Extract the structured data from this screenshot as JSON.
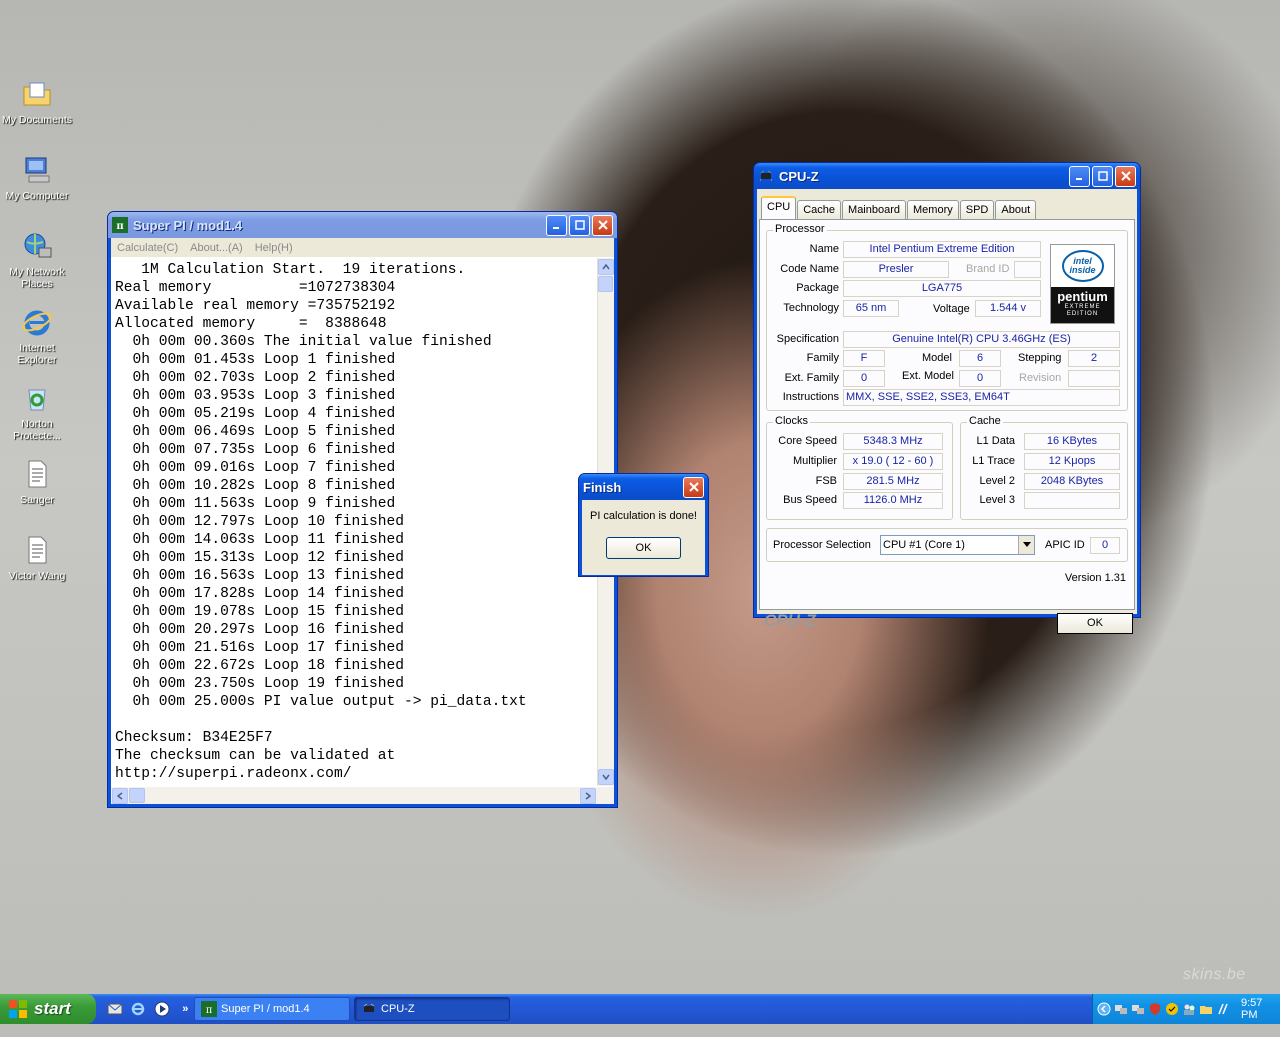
{
  "desktop": {
    "icons": [
      {
        "label": "My Documents"
      },
      {
        "label": "My Computer"
      },
      {
        "label": "My Network Places"
      },
      {
        "label": "Internet Explorer"
      },
      {
        "label": "Norton Protecte..."
      },
      {
        "label": "Sanger"
      },
      {
        "label": "Victor Wang"
      }
    ],
    "watermark": "skins.be"
  },
  "superpi": {
    "title": "Super PI / mod1.4",
    "icon_text": "SUPER π",
    "menu": [
      "Calculate(C)",
      "About...(A)",
      "Help(H)"
    ],
    "output_lines": [
      "   1M Calculation Start.  19 iterations.",
      "Real memory          =1072738304",
      "Available real memory =735752192",
      "Allocated memory     =  8388648",
      "  0h 00m 00.360s The initial value finished",
      "  0h 00m 01.453s Loop 1 finished",
      "  0h 00m 02.703s Loop 2 finished",
      "  0h 00m 03.953s Loop 3 finished",
      "  0h 00m 05.219s Loop 4 finished",
      "  0h 00m 06.469s Loop 5 finished",
      "  0h 00m 07.735s Loop 6 finished",
      "  0h 00m 09.016s Loop 7 finished",
      "  0h 00m 10.282s Loop 8 finished",
      "  0h 00m 11.563s Loop 9 finished",
      "  0h 00m 12.797s Loop 10 finished",
      "  0h 00m 14.063s Loop 11 finished",
      "  0h 00m 15.313s Loop 12 finished",
      "  0h 00m 16.563s Loop 13 finished",
      "  0h 00m 17.828s Loop 14 finished",
      "  0h 00m 19.078s Loop 15 finished",
      "  0h 00m 20.297s Loop 16 finished",
      "  0h 00m 21.516s Loop 17 finished",
      "  0h 00m 22.672s Loop 18 finished",
      "  0h 00m 23.750s Loop 19 finished",
      "  0h 00m 25.000s PI value output -> pi_data.txt",
      "",
      "Checksum: B34E25F7",
      "The checksum can be validated at",
      "http://superpi.radeonx.com/"
    ]
  },
  "finish_dialog": {
    "title": "Finish",
    "message": "PI calculation is done!",
    "ok_label": "OK"
  },
  "cpuz": {
    "title": "CPU-Z",
    "tabs": [
      "CPU",
      "Cache",
      "Mainboard",
      "Memory",
      "SPD",
      "About"
    ],
    "processor": {
      "group_label": "Processor",
      "name_label": "Name",
      "name": "Intel Pentium Extreme Edition",
      "codename_label": "Code Name",
      "codename": "Presler",
      "brandid_label": "Brand ID",
      "brandid": "",
      "package_label": "Package",
      "package": "LGA775",
      "technology_label": "Technology",
      "technology": "65 nm",
      "voltage_label": "Voltage",
      "voltage": "1.544 v",
      "spec_label": "Specification",
      "spec": "Genuine Intel(R) CPU 3.46GHz (ES)",
      "family_label": "Family",
      "family": "F",
      "model_label": "Model",
      "model": "6",
      "stepping_label": "Stepping",
      "stepping": "2",
      "extfamily_label": "Ext. Family",
      "extfamily": "0",
      "extmodel_label": "Ext. Model",
      "extmodel": "0",
      "revision_label": "Revision",
      "revision": "",
      "instructions_label": "Instructions",
      "instructions": "MMX, SSE, SSE2, SSE3, EM64T",
      "logo_top": "intel inside",
      "logo_brand": "pentium",
      "logo_sub": "EXTREME EDITION"
    },
    "clocks": {
      "group_label": "Clocks",
      "corespeed_label": "Core Speed",
      "corespeed": "5348.3 MHz",
      "multiplier_label": "Multiplier",
      "multiplier": "x 19.0  ( 12 - 60 )",
      "fsb_label": "FSB",
      "fsb": "281.5 MHz",
      "busspeed_label": "Bus Speed",
      "busspeed": "1126.0 MHz"
    },
    "cache": {
      "group_label": "Cache",
      "l1data_label": "L1 Data",
      "l1data": "16 KBytes",
      "l1trace_label": "L1 Trace",
      "l1trace": "12 Kμops",
      "level2_label": "Level 2",
      "level2": "2048 KBytes",
      "level3_label": "Level 3",
      "level3": ""
    },
    "selection": {
      "label": "Processor Selection",
      "value": "CPU #1 (Core 1)",
      "apic_label": "APIC ID",
      "apic": "0"
    },
    "version": "Version 1.31",
    "brand": "CPU-Z",
    "ok_label": "OK"
  },
  "taskbar": {
    "start_label": "start",
    "tasks": [
      {
        "label": "Super PI / mod1.4"
      },
      {
        "label": "CPU-Z"
      }
    ],
    "clock": "9:57 PM"
  }
}
